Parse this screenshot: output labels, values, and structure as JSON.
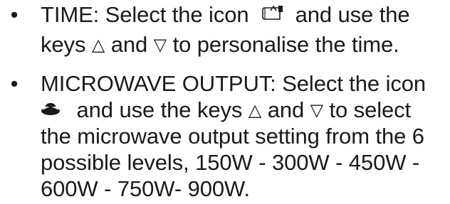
{
  "items": [
    {
      "bullet": "•",
      "lines": [
        {
          "text_a": "TIME: Select the icon",
          "icon": "clock-timer-icon",
          "text_b": "and use the"
        },
        {
          "text_a": "keys",
          "key_up": "△",
          "text_and": "and",
          "key_down": "▽",
          "text_b": "to personalise the time."
        }
      ]
    },
    {
      "bullet": "•",
      "lines": [
        {
          "text": "MICROWAVE OUTPUT: Select the icon"
        },
        {
          "icon": "microwave-waves-icon",
          "text_a": "and use the keys",
          "key_up": "△",
          "text_and": "and",
          "key_down": "▽",
          "text_b": "to select"
        },
        {
          "text": "the microwave output setting from the 6"
        },
        {
          "text": "possible levels, 150W - 300W - 450W -"
        },
        {
          "text": "600W - 750W- 900W."
        }
      ]
    }
  ]
}
